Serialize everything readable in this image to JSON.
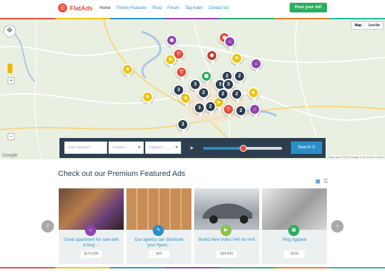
{
  "brand": {
    "name": "FlatAds",
    "icon": "menu-list-icon"
  },
  "nav": [
    {
      "label": "Home",
      "active": true
    },
    {
      "label": "Theme Features",
      "active": false
    },
    {
      "label": "Shop",
      "active": false
    },
    {
      "label": "Forum",
      "active": false
    },
    {
      "label": "Tag Index",
      "active": false
    },
    {
      "label": "Contact Us",
      "active": false
    }
  ],
  "header": {
    "post_button": "Post your Ad!"
  },
  "map": {
    "type_options": [
      "Map",
      "Satellite"
    ],
    "google_label": "Google",
    "footer_note": "Map data ©2016 Google   2 km   Terms of Use",
    "pins": [
      {
        "kind": "icon",
        "icon": "github-icon",
        "color": "#8e44ad"
      },
      {
        "kind": "icon",
        "icon": "heart-icon",
        "color": "#e74c3c"
      },
      {
        "kind": "icon",
        "icon": "github-icon",
        "color": "#c0392b"
      },
      {
        "kind": "icon",
        "icon": "github-icon",
        "color": "#e74c3c"
      },
      {
        "kind": "icon",
        "icon": "briefcase-icon",
        "color": "#f1c40f"
      },
      {
        "kind": "icon",
        "icon": "home-icon",
        "color": "#8e44ad"
      },
      {
        "kind": "icon",
        "icon": "home-icon",
        "color": "#8e44ad"
      },
      {
        "kind": "icon",
        "icon": "heart-icon",
        "color": "#e74c3c"
      },
      {
        "kind": "icon",
        "icon": "briefcase-icon",
        "color": "#f1c40f"
      },
      {
        "kind": "icon",
        "icon": "briefcase-icon",
        "color": "#f1c40f"
      },
      {
        "kind": "icon",
        "icon": "briefcase-icon",
        "color": "#f1c40f"
      },
      {
        "kind": "icon",
        "icon": "briefcase-icon",
        "color": "#f1c40f"
      },
      {
        "kind": "icon",
        "icon": "briefcase-icon",
        "color": "#f1c40f"
      },
      {
        "kind": "icon",
        "icon": "cart-icon",
        "color": "#27ae60"
      },
      {
        "kind": "icon",
        "icon": "heart-icon",
        "color": "#e74c3c"
      },
      {
        "kind": "icon",
        "icon": "home-icon",
        "color": "#8e44ad"
      },
      {
        "kind": "icon",
        "icon": "briefcase-icon",
        "color": "#f1c40f"
      },
      {
        "kind": "count",
        "label": "3",
        "color": "#2c3e50"
      },
      {
        "kind": "count",
        "label": "3",
        "color": "#2c3e50"
      },
      {
        "kind": "count",
        "label": "2",
        "color": "#2c3e50"
      },
      {
        "kind": "count",
        "label": "2",
        "color": "#2c3e50"
      },
      {
        "kind": "count",
        "label": "3",
        "color": "#2c3e50"
      },
      {
        "kind": "count",
        "label": "3",
        "color": "#2c3e50"
      },
      {
        "kind": "count",
        "label": "2",
        "color": "#2c3e50"
      },
      {
        "kind": "count",
        "label": "2",
        "color": "#2c3e50"
      },
      {
        "kind": "count",
        "label": "2",
        "color": "#2c3e50"
      },
      {
        "kind": "count",
        "label": "3",
        "color": "#2c3e50"
      },
      {
        "kind": "count",
        "label": "2",
        "color": "#2c3e50"
      },
      {
        "kind": "count",
        "label": "2",
        "color": "#2c3e50"
      },
      {
        "kind": "count",
        "label": "3",
        "color": "#2c3e50"
      }
    ]
  },
  "search": {
    "keyword_placeholder": "Enter keyword...",
    "location_placeholder": "Location...",
    "category_placeholder": "Category...",
    "radius_fraction": 0.51,
    "button_label": "Search"
  },
  "featured": {
    "title": "Check out our Premium Featured Ads",
    "cards": [
      {
        "title": "Great apartment for sale with a long ...",
        "price": "$170,000",
        "icon": "home-icon",
        "icon_color": "#8e44ad",
        "image": "living-room-photo"
      },
      {
        "title": "Our agency can distribute your flyers...",
        "price": "$10",
        "icon": "pen-icon",
        "icon_color": "#2a8fc9",
        "image": "mailboxes-photo"
      },
      {
        "title": "Brand New Volvo V40 for rent",
        "price": "$34,000",
        "icon": "car-icon",
        "icon_color": "#8bc34a",
        "image": "car-photo"
      },
      {
        "title": "Ping Apparel",
        "price": "$150",
        "icon": "cart-icon",
        "icon_color": "#27ae60",
        "image": "golf-club-photo"
      }
    ]
  },
  "colors": {
    "accent": "#2a8fc9",
    "brand": "#e74c3c",
    "post": "#27ae60",
    "searchbar": "#2c3e50",
    "stripe": [
      "#e74c3c",
      "#f1c40f",
      "#2a8fc9",
      "#8e44ad",
      "#27ae60",
      "#e67e22",
      "#1abc9c"
    ]
  }
}
